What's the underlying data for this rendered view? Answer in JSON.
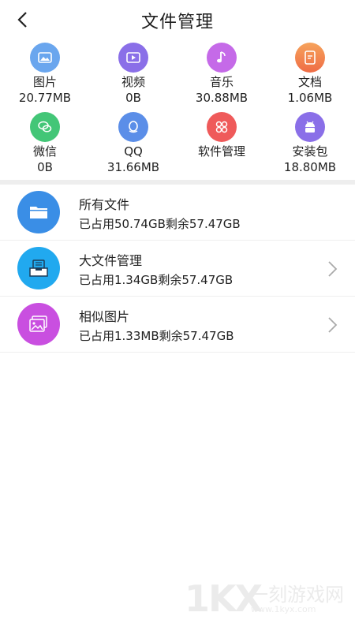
{
  "header": {
    "title": "文件管理",
    "back_icon": "chevron-left-icon"
  },
  "categories": [
    {
      "label": "图片",
      "size": "20.77MB",
      "icon": "image-icon",
      "color": "#6aa6ee"
    },
    {
      "label": "视频",
      "size": "0B",
      "icon": "video-icon",
      "color": "#8a6fe8"
    },
    {
      "label": "音乐",
      "size": "30.88MB",
      "icon": "music-note-icon",
      "color": "#c56ae8"
    },
    {
      "label": "文档",
      "size": "1.06MB",
      "icon": "document-icon",
      "color": "#f2834e"
    },
    {
      "label": "微信",
      "size": "0B",
      "icon": "wechat-icon",
      "color": "#43c677"
    },
    {
      "label": "QQ",
      "size": "31.66MB",
      "icon": "qq-penguin-icon",
      "color": "#5b8ee8"
    },
    {
      "label": "软件管理",
      "size": "",
      "icon": "apps-icon",
      "color": "#ef5a5a"
    },
    {
      "label": "安装包",
      "size": "18.80MB",
      "icon": "android-icon",
      "color": "#8a6fe8"
    }
  ],
  "rows": [
    {
      "title": "所有文件",
      "subtitle": "已占用50.74GB剩余57.47GB",
      "icon": "folder-icon",
      "color": "#3a8ee6",
      "chevron": false
    },
    {
      "title": "大文件管理",
      "subtitle": "已占用1.34GB剩余57.47GB",
      "icon": "file-box-icon",
      "color": "#21a9ef",
      "chevron": true
    },
    {
      "title": "相似图片",
      "subtitle": "已占用1.33MB剩余57.47GB",
      "icon": "gallery-icon",
      "color": "#c94fe0",
      "chevron": true
    }
  ],
  "watermark": {
    "logo": "1KX",
    "text": "一刻游戏网",
    "url": "www.1kyx.com"
  }
}
